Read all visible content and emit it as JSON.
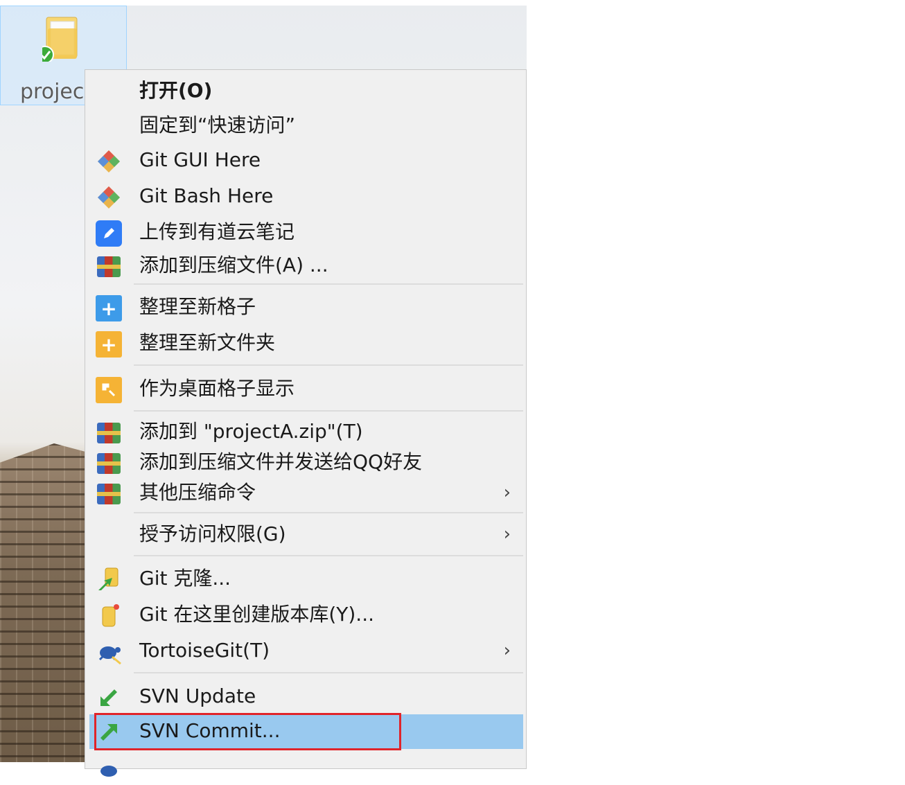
{
  "desktop": {
    "folder_label": "projec"
  },
  "menu": {
    "items": [
      {
        "label": "打开(O)",
        "bold": true,
        "icon": "none"
      },
      {
        "label": "固定到“快速访问”",
        "icon": "none"
      },
      {
        "label": "Git GUI Here",
        "icon": "git-gui-icon"
      },
      {
        "label": "Git Bash Here",
        "icon": "git-bash-icon"
      },
      {
        "label": "上传到有道云笔记",
        "icon": "youdao-note-icon"
      },
      {
        "label": "添加到压缩文件(A) ...",
        "icon": "archive-icon"
      },
      {
        "label": "整理至新格子",
        "icon": "plus-blue-icon"
      },
      {
        "label": "整理至新文件夹",
        "icon": "plus-orange-icon"
      },
      {
        "label": "作为桌面格子显示",
        "icon": "desktop-grid-icon"
      },
      {
        "label": "添加到 \"projectA.zip\"(T)",
        "icon": "archive-icon"
      },
      {
        "label": "添加到压缩文件并发送给QQ好友",
        "icon": "archive-icon"
      },
      {
        "label": "其他压缩命令",
        "icon": "archive-icon",
        "submenu": true
      },
      {
        "label": "授予访问权限(G)",
        "icon": "none",
        "submenu": true
      },
      {
        "label": "Git 克隆...",
        "icon": "git-clone-icon"
      },
      {
        "label": "Git 在这里创建版本库(Y)...",
        "icon": "git-create-repo-icon"
      },
      {
        "label": "TortoiseGit(T)",
        "icon": "tortoisegit-icon",
        "submenu": true
      },
      {
        "label": "SVN Update",
        "icon": "svn-update-icon"
      },
      {
        "label": "SVN Commit...",
        "icon": "svn-commit-icon",
        "highlighted": true
      }
    ],
    "submenu_arrow": "›"
  },
  "colors": {
    "menu_bg": "#f0f0f0",
    "highlight": "#99c9ef",
    "annotation_red": "#e0242a"
  }
}
